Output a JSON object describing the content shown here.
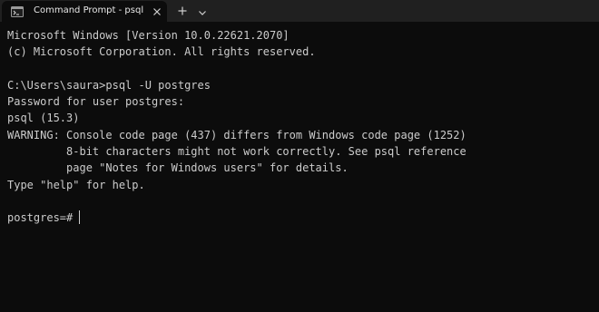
{
  "tab": {
    "title": "Command Prompt - psql -U p",
    "icon": "terminal-icon",
    "close_icon": "close-icon"
  },
  "tabbar": {
    "new_tab_icon": "plus-icon",
    "dropdown_icon": "chevron-down-icon"
  },
  "terminal": {
    "lines": [
      "Microsoft Windows [Version 10.0.22621.2070]",
      "(c) Microsoft Corporation. All rights reserved.",
      "",
      "C:\\Users\\saura>psql -U postgres",
      "Password for user postgres:",
      "psql (15.3)",
      "WARNING: Console code page (437) differs from Windows code page (1252)",
      "         8-bit characters might not work correctly. See psql reference",
      "         page \"Notes for Windows users\" for details.",
      "Type \"help\" for help.",
      ""
    ],
    "prompt": "postgres=# "
  },
  "colors": {
    "background": "#0c0c0c",
    "titlebar": "#202020",
    "text": "#cccccc"
  }
}
